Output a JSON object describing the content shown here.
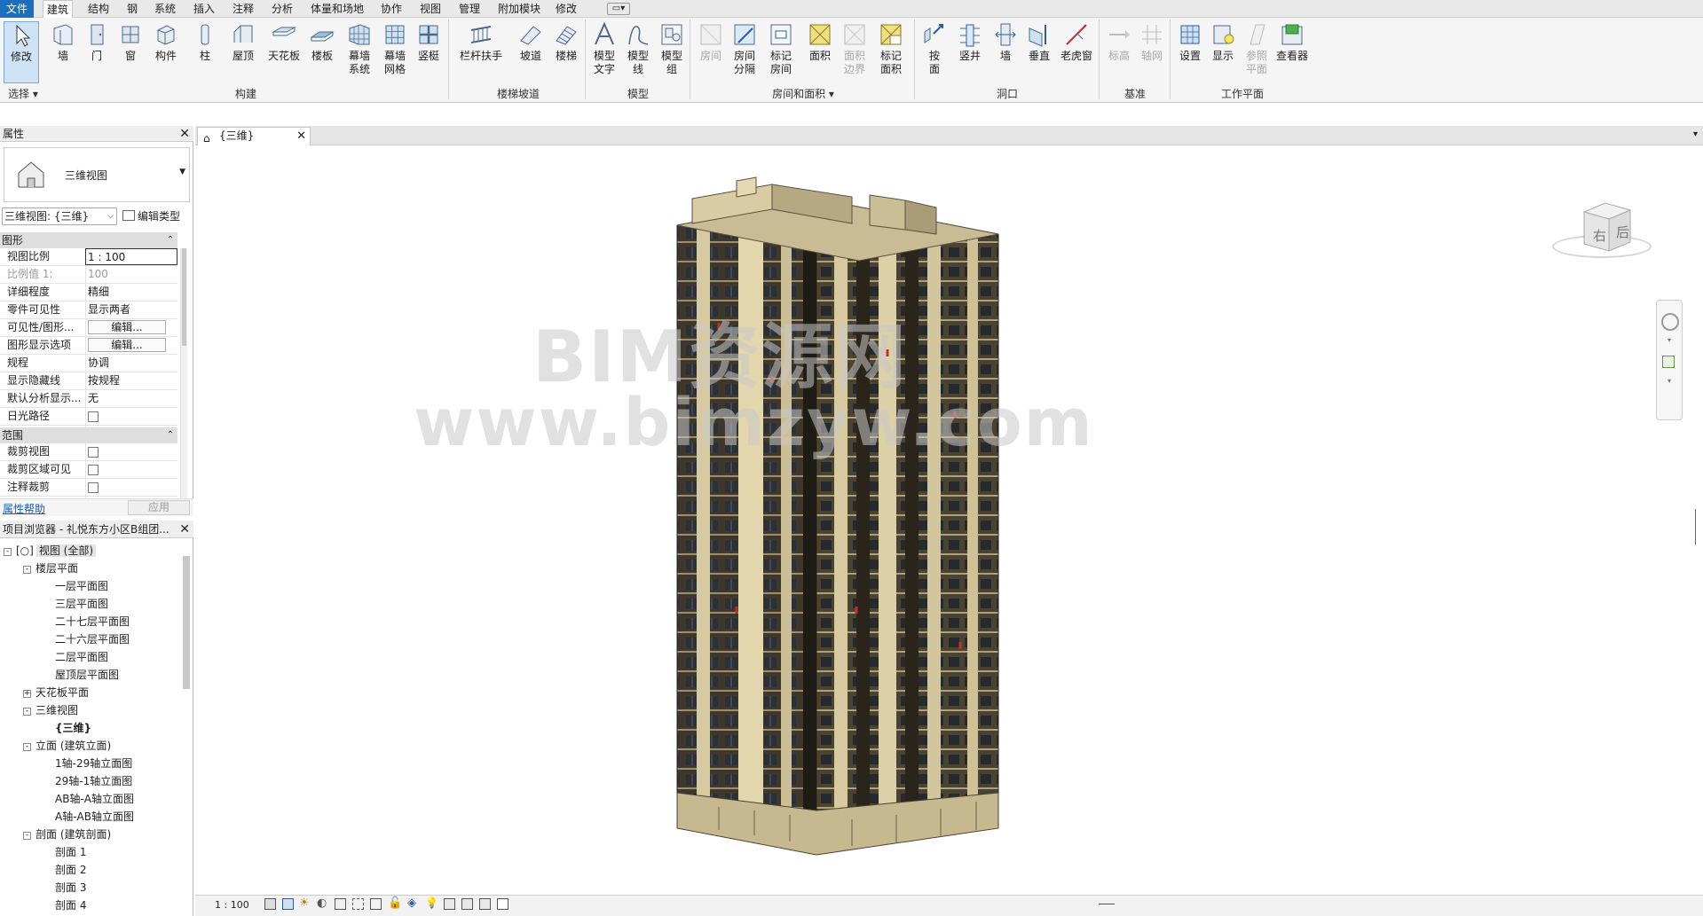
{
  "menubar": {
    "file": "文件",
    "tabs": [
      "建筑",
      "结构",
      "钢",
      "系统",
      "插入",
      "注释",
      "分析",
      "体量和场地",
      "协作",
      "视图",
      "管理",
      "附加模块",
      "修改"
    ],
    "active": "建筑"
  },
  "ribbon": {
    "buttons": [
      {
        "label": "修改",
        "icon": "cursor-icon",
        "state": "selected"
      },
      {
        "label": "墙",
        "icon": "wall-icon"
      },
      {
        "label": "门",
        "icon": "door-icon"
      },
      {
        "label": "窗",
        "icon": "window-icon"
      },
      {
        "label": "构件",
        "icon": "component-icon"
      },
      {
        "label": "柱",
        "icon": "column-icon"
      },
      {
        "label": "屋顶",
        "icon": "roof-icon"
      },
      {
        "label": "天花板",
        "icon": "ceiling-icon"
      },
      {
        "label": "楼板",
        "icon": "floor-icon"
      },
      {
        "label": "幕墙\n系统",
        "icon": "curtain-system-icon"
      },
      {
        "label": "幕墙\n网格",
        "icon": "curtain-grid-icon"
      },
      {
        "label": "竖梃",
        "icon": "mullion-icon"
      },
      {
        "label": "栏杆扶手",
        "icon": "railing-icon"
      },
      {
        "label": "坡道",
        "icon": "ramp-icon"
      },
      {
        "label": "楼梯",
        "icon": "stair-icon"
      },
      {
        "label": "模型\n文字",
        "icon": "model-text-icon"
      },
      {
        "label": "模型\n线",
        "icon": "model-line-icon"
      },
      {
        "label": "模型\n组",
        "icon": "model-group-icon"
      },
      {
        "label": "房间",
        "icon": "room-icon",
        "state": "disabled"
      },
      {
        "label": "房间\n分隔",
        "icon": "room-separator-icon"
      },
      {
        "label": "标记\n房间",
        "icon": "tag-room-icon"
      },
      {
        "label": "面积",
        "icon": "area-icon"
      },
      {
        "label": "面积\n边界",
        "icon": "area-boundary-icon",
        "state": "disabled"
      },
      {
        "label": "标记\n面积",
        "icon": "tag-area-icon"
      },
      {
        "label": "按\n面",
        "icon": "by-face-icon"
      },
      {
        "label": "竖井",
        "icon": "shaft-icon"
      },
      {
        "label": "墙",
        "icon": "wall-opening-icon"
      },
      {
        "label": "垂直",
        "icon": "vertical-icon"
      },
      {
        "label": "老虎窗",
        "icon": "dormer-icon"
      },
      {
        "label": "标高",
        "icon": "level-icon",
        "state": "disabled"
      },
      {
        "label": "轴网",
        "icon": "grid-icon",
        "state": "disabled"
      },
      {
        "label": "设置",
        "icon": "set-icon"
      },
      {
        "label": "显示",
        "icon": "show-icon"
      },
      {
        "label": "参照\n平面",
        "icon": "ref-plane-icon",
        "state": "disabled"
      },
      {
        "label": "查看器",
        "icon": "viewer-icon"
      }
    ],
    "groups": [
      "选择",
      "构建",
      "楼梯坡道",
      "模型",
      "房间和面积",
      "洞口",
      "基准",
      "工作平面"
    ]
  },
  "properties": {
    "title": "属性",
    "type_name": "三维视图",
    "selector": "三维视图: {三维}",
    "edit_type": "编辑类型",
    "section_graphics": "图形",
    "section_extents": "范围",
    "rows": [
      {
        "k": "视图比例",
        "v": "1 : 100"
      },
      {
        "k": "比例值 1:",
        "v": "100"
      },
      {
        "k": "详细程度",
        "v": "精细"
      },
      {
        "k": "零件可见性",
        "v": "显示两者"
      },
      {
        "k": "可见性/图形...",
        "v": "编辑..."
      },
      {
        "k": "图形显示选项",
        "v": "编辑..."
      },
      {
        "k": "规程",
        "v": "协调"
      },
      {
        "k": "显示隐藏线",
        "v": "按规程"
      },
      {
        "k": "默认分析显示...",
        "v": "无"
      },
      {
        "k": "日光路径",
        "v": ""
      }
    ],
    "extent_rows": [
      {
        "k": "裁剪视图",
        "v": ""
      },
      {
        "k": "裁剪区域可见",
        "v": ""
      },
      {
        "k": "注释裁剪",
        "v": ""
      }
    ],
    "help": "属性帮助",
    "apply": "应用"
  },
  "browser": {
    "title": "项目浏览器 - 礼悦东方小区B组团...",
    "nodes": [
      {
        "label": "视图 (全部)",
        "level": 0,
        "toggle": "-"
      },
      {
        "label": "楼层平面",
        "level": 1,
        "toggle": "-"
      },
      {
        "label": "一层平面图",
        "level": 2
      },
      {
        "label": "三层平面图",
        "level": 2
      },
      {
        "label": "二十七层平面图",
        "level": 2
      },
      {
        "label": "二十六层平面图",
        "level": 2
      },
      {
        "label": "二层平面图",
        "level": 2
      },
      {
        "label": "屋顶层平面图",
        "level": 2
      },
      {
        "label": "天花板平面",
        "level": 1,
        "toggle": "+"
      },
      {
        "label": "三维视图",
        "level": 1,
        "toggle": "-"
      },
      {
        "label": "{三维}",
        "level": 2,
        "bold": true
      },
      {
        "label": "立面 (建筑立面)",
        "level": 1,
        "toggle": "-"
      },
      {
        "label": "1轴-29轴立面图",
        "level": 2
      },
      {
        "label": "29轴-1轴立面图",
        "level": 2
      },
      {
        "label": "AB轴-A轴立面图",
        "level": 2
      },
      {
        "label": "A轴-AB轴立面图",
        "level": 2
      },
      {
        "label": "剖面 (建筑剖面)",
        "level": 1,
        "toggle": "-"
      },
      {
        "label": "剖面 1",
        "level": 2
      },
      {
        "label": "剖面 2",
        "level": 2
      },
      {
        "label": "剖面 3",
        "level": 2
      },
      {
        "label": "剖面 4",
        "level": 2
      }
    ]
  },
  "view": {
    "tab": "{三维}",
    "viewcube_right": "右",
    "viewcube_back": "后",
    "watermark1": "BIM资源网",
    "watermark2": "www.bimzyw.com"
  },
  "status": {
    "scale": "1 : 100"
  }
}
